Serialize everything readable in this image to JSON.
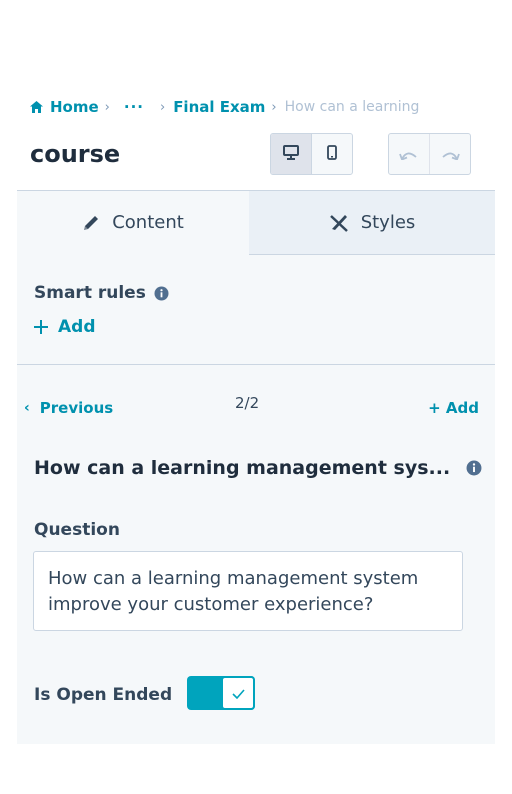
{
  "breadcrumb": {
    "home": "Home",
    "ellipsis": "···",
    "item2": "Final Exam",
    "current": "How can a learning"
  },
  "page_title": "course",
  "tabs": {
    "content": "Content",
    "styles": "Styles"
  },
  "smart_rules": {
    "label": "Smart rules",
    "add": "Add"
  },
  "pagination": {
    "previous": "Previous",
    "position": "2/2",
    "add": "+ Add"
  },
  "question_header": "How can a learning management sys...",
  "question_field": {
    "label": "Question",
    "value": "How can a learning management system improve your customer experience?"
  },
  "open_ended": {
    "label": "Is Open Ended",
    "checked": true
  },
  "colors": {
    "link": "#0091ae",
    "toggle": "#00a4bd",
    "panel_bg": "#f5f8fa",
    "text": "#33475b"
  }
}
